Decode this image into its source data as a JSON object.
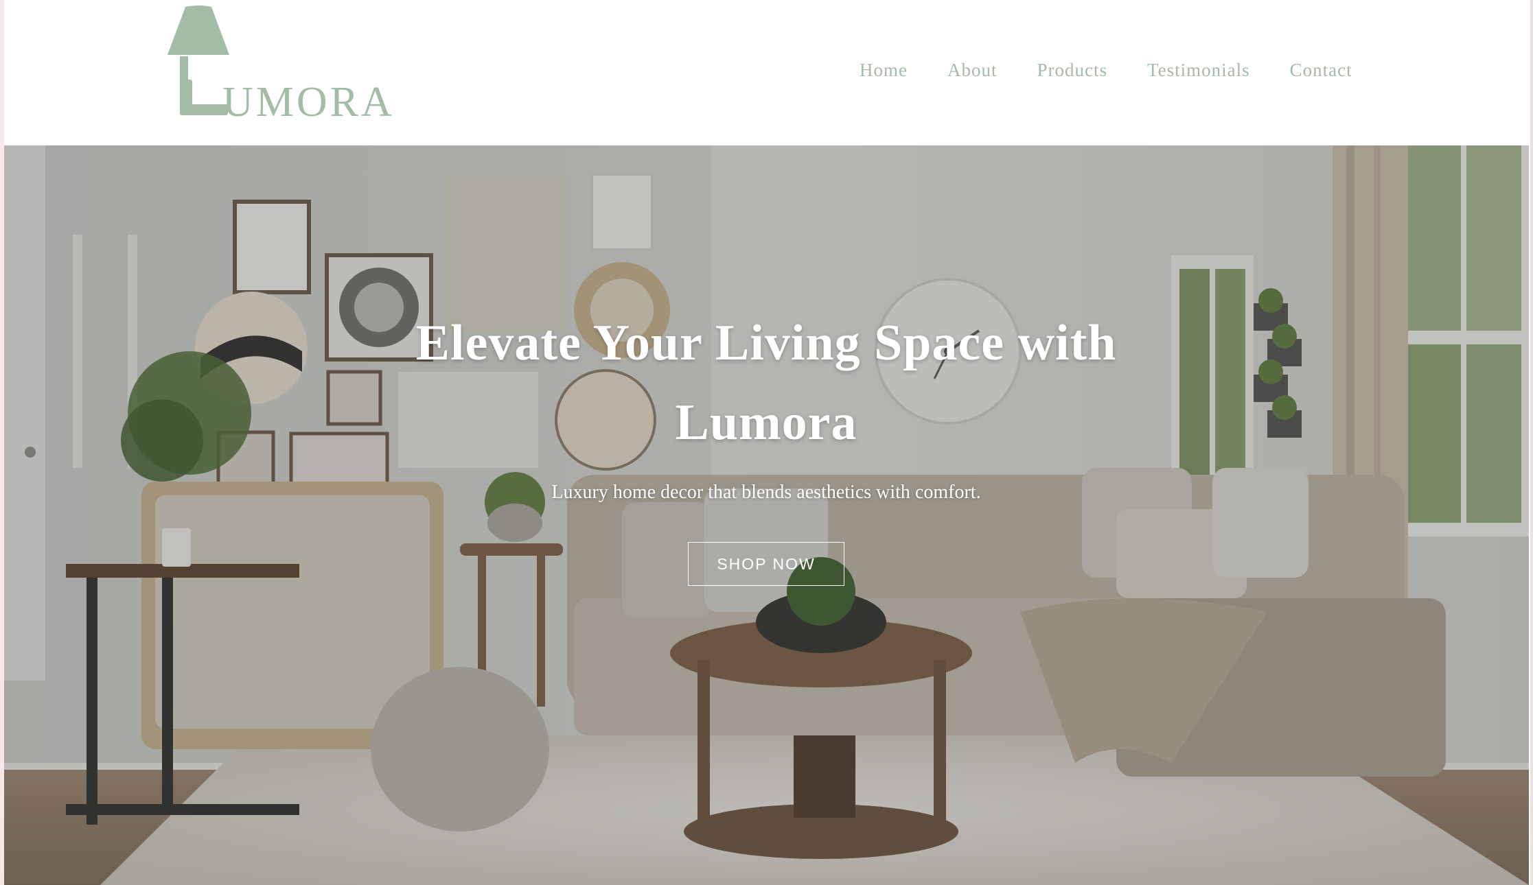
{
  "brand": {
    "name": "UMORA",
    "logo_icon": "lamp-icon",
    "color": "#a3bca6"
  },
  "nav": {
    "items": [
      {
        "label": "Home"
      },
      {
        "label": "About"
      },
      {
        "label": "Products"
      },
      {
        "label": "Testimonials"
      },
      {
        "label": "Contact"
      }
    ]
  },
  "hero": {
    "title": "Elevate Your Living Space with Lumora",
    "subtitle": "Luxury home decor that blends aesthetics with comfort.",
    "cta_label": "SHOP NOW",
    "background": "living-room-photo"
  }
}
